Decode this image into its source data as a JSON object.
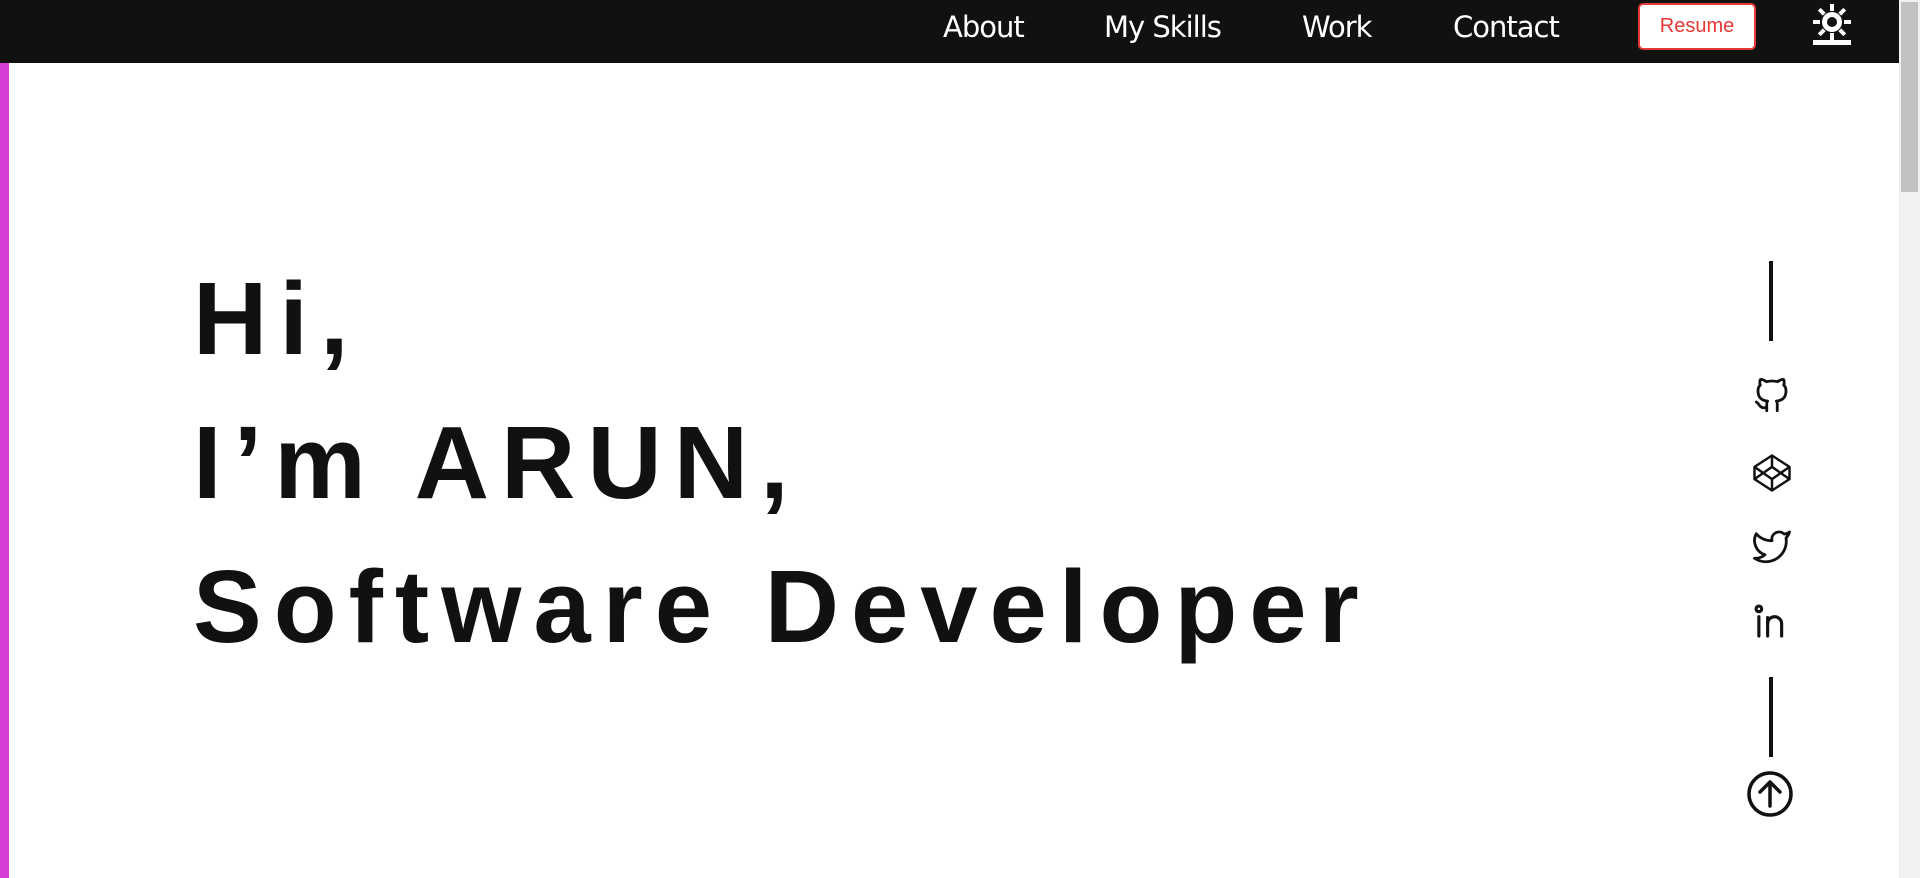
{
  "colors": {
    "nav_background": "#111111",
    "nav_text": "#ffffff",
    "resume_accent": "#e53935",
    "left_stripe": "#d63ed6",
    "hero_text": "#111111"
  },
  "nav": {
    "links": [
      "About",
      "My Skills",
      "Work",
      "Contact"
    ],
    "resume_label": "Resume",
    "theme_icon": "sun-icon"
  },
  "hero": {
    "greeting": "Hi,",
    "intro": "I’m ARUN,",
    "role": "Software Developer"
  },
  "social": {
    "icons": [
      "github-icon",
      "codepen-icon",
      "twitter-icon",
      "linkedin-icon"
    ],
    "scroll_top_icon": "arrow-up-circle-icon"
  }
}
